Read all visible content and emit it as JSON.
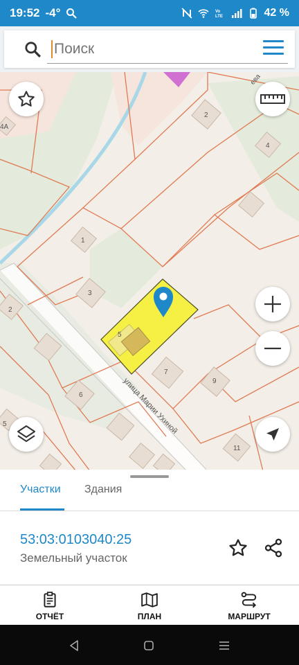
{
  "status": {
    "time": "19:52",
    "temperature": "-4°",
    "battery": "42 %",
    "icons": [
      "search-icon",
      "nfc-off-icon",
      "wifi-icon",
      "volte-icon",
      "signal-icon",
      "battery-icon"
    ]
  },
  "search": {
    "placeholder": "Поиск",
    "icon": "search-icon",
    "menu_icon": "menu-icon"
  },
  "map": {
    "parcel_numbers": [
      "2",
      "4",
      "1",
      "3",
      "5",
      "7",
      "9",
      "6",
      "11",
      "2",
      "5"
    ],
    "street_name": "улица Марии Ухиной",
    "street_partial": "ева",
    "parcel_partial": "4А",
    "colors": {
      "parcel_border": "#e07a52",
      "selected_fill": "#f5f043",
      "pin": "#1e88c8",
      "water": "#a8d8e8",
      "background": "#f3eee7",
      "green": "#dfe8d6"
    },
    "controls": [
      "favorite-star-icon",
      "ruler-icon",
      "zoom-in-icon",
      "zoom-out-icon",
      "layers-icon",
      "my-location-icon"
    ]
  },
  "sheet": {
    "tabs": [
      {
        "label": "Участки",
        "active": true
      },
      {
        "label": "Здания",
        "active": false
      }
    ],
    "cadastral_number": "53:03:0103040:25",
    "parcel_type": "Земельный участок"
  },
  "bottom_nav": [
    {
      "label": "ОТЧЁТ",
      "icon": "report-icon"
    },
    {
      "label": "ПЛАН",
      "icon": "map-plan-icon"
    },
    {
      "label": "МАРШРУТ",
      "icon": "route-icon"
    }
  ],
  "system_nav": [
    "back-icon",
    "home-icon",
    "recents-icon"
  ]
}
